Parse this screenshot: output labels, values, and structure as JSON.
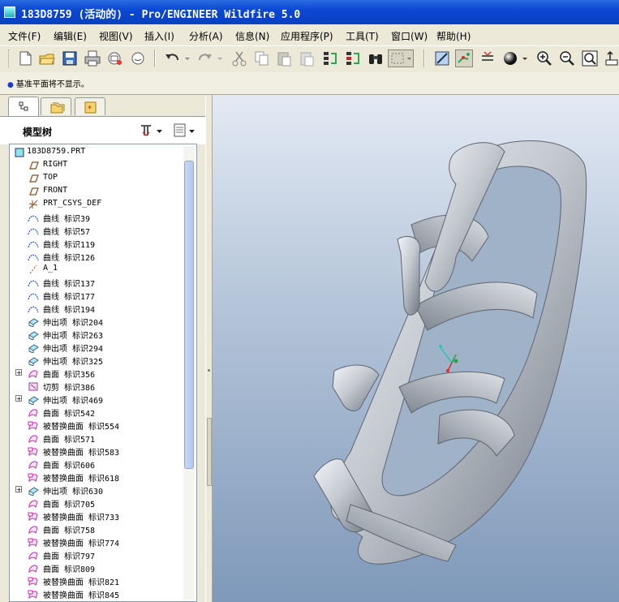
{
  "window": {
    "title": "183D8759 (活动的) - Pro/ENGINEER Wildfire 5.0"
  },
  "menu": [
    "文件(F)",
    "编辑(E)",
    "视图(V)",
    "插入(I)",
    "分析(A)",
    "信息(N)",
    "应用程序(P)",
    "工具(T)",
    "窗口(W)",
    "帮助(H)"
  ],
  "toolbar": {
    "buttons": [
      "new-file",
      "open",
      "save",
      "print",
      "email",
      "email-link",
      "undo",
      "redo",
      "cut",
      "copy",
      "paste",
      "paste-special",
      "regenerate",
      "regenerate-manager",
      "find",
      "select-box",
      "repaint",
      "spin-center",
      "orient",
      "shading",
      "zoom-in",
      "zoom-out",
      "refit",
      "more"
    ]
  },
  "message": {
    "text": "基准平面将不显示。"
  },
  "panel": {
    "tabs": [
      "model-tree-tab",
      "folder-browser-tab",
      "favorites-tab"
    ],
    "title": "模型树",
    "root": "183D8759.PRT",
    "items": [
      {
        "label": "RIGHT",
        "icon": "datum-plane-icon",
        "expandable": false
      },
      {
        "label": "TOP",
        "icon": "datum-plane-icon",
        "expandable": false
      },
      {
        "label": "FRONT",
        "icon": "datum-plane-icon",
        "expandable": false
      },
      {
        "label": "PRT_CSYS_DEF",
        "icon": "csys-icon",
        "expandable": false
      },
      {
        "label": "曲线 标识39",
        "icon": "curve-icon",
        "expandable": false
      },
      {
        "label": "曲线 标识57",
        "icon": "curve-icon",
        "expandable": false
      },
      {
        "label": "曲线 标识119",
        "icon": "curve-icon",
        "expandable": false
      },
      {
        "label": "曲线 标识126",
        "icon": "curve-icon",
        "expandable": false
      },
      {
        "label": "A_1",
        "icon": "axis-icon",
        "expandable": false
      },
      {
        "label": "曲线 标识137",
        "icon": "curve-icon",
        "expandable": false
      },
      {
        "label": "曲线 标识177",
        "icon": "curve-icon",
        "expandable": false
      },
      {
        "label": "曲线 标识194",
        "icon": "curve-icon",
        "expandable": false
      },
      {
        "label": "伸出项 标识204",
        "icon": "protrusion-icon",
        "expandable": false
      },
      {
        "label": "伸出项 标识263",
        "icon": "protrusion-icon",
        "expandable": false
      },
      {
        "label": "伸出项 标识294",
        "icon": "protrusion-icon",
        "expandable": false
      },
      {
        "label": "伸出项 标识325",
        "icon": "protrusion-icon",
        "expandable": false
      },
      {
        "label": "曲面 标识356",
        "icon": "surface-icon",
        "expandable": true
      },
      {
        "label": "切剪 标识386",
        "icon": "cut-icon",
        "expandable": false
      },
      {
        "label": "伸出项 标识469",
        "icon": "protrusion-icon",
        "expandable": true
      },
      {
        "label": "曲面 标识542",
        "icon": "surface-icon",
        "expandable": false
      },
      {
        "label": "被替换曲面 标识554",
        "icon": "replace-surface-icon",
        "expandable": false
      },
      {
        "label": "曲面 标识571",
        "icon": "surface-icon",
        "expandable": false
      },
      {
        "label": "被替换曲面 标识583",
        "icon": "replace-surface-icon",
        "expandable": false
      },
      {
        "label": "曲面 标识606",
        "icon": "surface-icon",
        "expandable": false
      },
      {
        "label": "被替换曲面 标识618",
        "icon": "replace-surface-icon",
        "expandable": false
      },
      {
        "label": "伸出项 标识630",
        "icon": "protrusion-icon",
        "expandable": true
      },
      {
        "label": "曲面 标识705",
        "icon": "surface-icon",
        "expandable": false
      },
      {
        "label": "被替换曲面 标识733",
        "icon": "replace-surface-icon",
        "expandable": false
      },
      {
        "label": "曲面 标识758",
        "icon": "surface-icon",
        "expandable": false
      },
      {
        "label": "被替换曲面 标识774",
        "icon": "replace-surface-icon",
        "expandable": false
      },
      {
        "label": "曲面 标识797",
        "icon": "surface-icon",
        "expandable": false
      },
      {
        "label": "曲面 标识809",
        "icon": "surface-icon",
        "expandable": false
      },
      {
        "label": "被替换曲面 标识821",
        "icon": "replace-surface-icon",
        "expandable": false
      },
      {
        "label": "被替换曲面 标识845",
        "icon": "replace-surface-icon",
        "expandable": false
      }
    ]
  },
  "colors": {
    "titlebar": "#0b48d4",
    "viewport_top": "#e3eaf4",
    "viewport_bottom": "#7f99ba",
    "model": "#c7ccd3",
    "curve_icon": "#1a56d6",
    "surface_icon": "#c02bb7"
  }
}
